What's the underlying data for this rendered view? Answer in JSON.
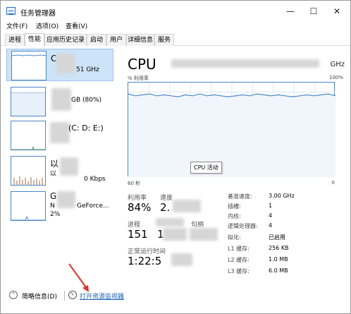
{
  "window": {
    "title": "任务管理器",
    "controls": {
      "minimize": "—",
      "maximize": "☐",
      "close": "✕"
    }
  },
  "menu": {
    "file": "文件(F)",
    "options": "选项(O)",
    "view": "查看(V)"
  },
  "tabs": [
    "进程",
    "性能",
    "应用历史记录",
    "启动",
    "用户",
    "详细信息",
    "服务"
  ],
  "active_tab": "性能",
  "sidebar": {
    "items": [
      {
        "title": "C",
        "sub": "51 GHz"
      },
      {
        "title": "",
        "sub": "GB (80%)"
      },
      {
        "title": "",
        "sub": "(C: D: E:)"
      },
      {
        "title": "以",
        "sub_line1": "以",
        "sub_line2": "0 Kbps"
      },
      {
        "title": "G",
        "sub_line1": "N",
        "sub_line1_tail": "GeForce...",
        "sub_line2": "2%"
      }
    ]
  },
  "cpu": {
    "title": "CPU",
    "model_tail": "GHz",
    "utilization_label": "% 利用率",
    "utilization_max": "100%",
    "tooltip": "CPU 活动",
    "axis_left": "60 秒",
    "axis_right": "0",
    "stats": {
      "utilization_label": "利用率",
      "utilization_value": "84%",
      "speed_label": "速度",
      "speed_value": "2.",
      "processes_label": "进程",
      "processes_value": "151",
      "threads_value": "1",
      "handles_label": "句柄",
      "uptime_label": "正常运行时间",
      "uptime_value": "1:22:5"
    },
    "details": [
      {
        "label": "基准速度:",
        "value": "3.00 GHz"
      },
      {
        "label": "插槽:",
        "value": "1"
      },
      {
        "label": "内核:",
        "value": "4"
      },
      {
        "label": "逻辑处理器:",
        "value": "4"
      },
      {
        "label": "拟化:",
        "value": "已启用"
      },
      {
        "label": "L1 缓存:",
        "value": "256 KB"
      },
      {
        "label": "L2 缓存:",
        "value": "1.0 MB"
      },
      {
        "label": "L3 缓存:",
        "value": "6.0 MB"
      }
    ],
    "graph_history": [
      88,
      86,
      87,
      88,
      86,
      87,
      86,
      85,
      87,
      86,
      88,
      86,
      87,
      86,
      85,
      86,
      87,
      86,
      88,
      87,
      86,
      87,
      86,
      85,
      86,
      87,
      86,
      87,
      88,
      86
    ],
    "graph_color": "#4a87c6"
  },
  "bottom": {
    "fewer_details": "简略信息(D)",
    "resource_monitor": "打开资源监视器"
  },
  "accent_color": "#1a5fb4",
  "annotation_arrow_color": "#e0302a"
}
